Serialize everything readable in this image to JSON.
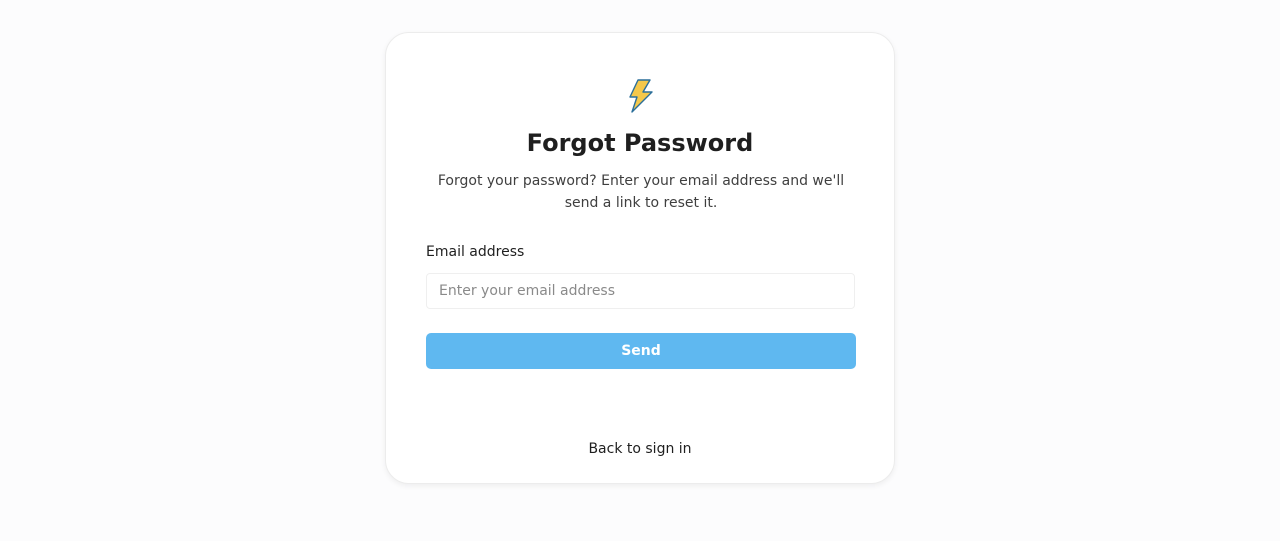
{
  "card": {
    "logo_icon": "lightning-bolt-icon",
    "title": "Forgot Password",
    "subtitle": "Forgot your password? Enter your email address and we'll send a link to reset it.",
    "email": {
      "label": "Email address",
      "value": "",
      "placeholder": "Enter your email address"
    },
    "send_label": "Send",
    "back_link": "Back to sign in"
  },
  "colors": {
    "accent": "#5fb8f0",
    "bolt_fill": "#f5c84b",
    "bolt_stroke": "#2b6f9a"
  }
}
